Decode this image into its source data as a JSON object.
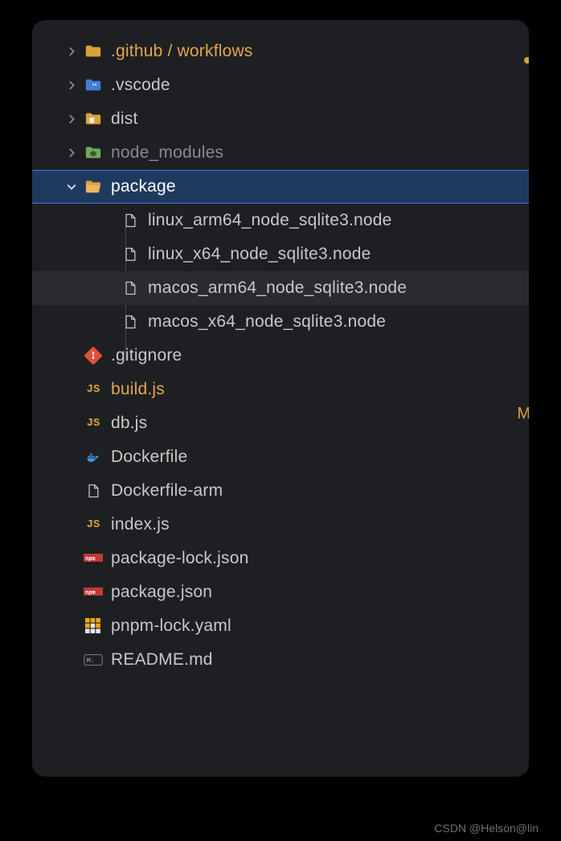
{
  "tree": {
    "items": [
      {
        "type": "folder",
        "label": ".github / workflows",
        "expanded": false,
        "icon": "folder-git",
        "highlighted": true,
        "indent": 0
      },
      {
        "type": "folder",
        "label": ".vscode",
        "expanded": false,
        "icon": "folder-vscode",
        "indent": 0
      },
      {
        "type": "folder",
        "label": "dist",
        "expanded": false,
        "icon": "folder-dist",
        "indent": 0
      },
      {
        "type": "folder",
        "label": "node_modules",
        "expanded": false,
        "icon": "folder-node",
        "muted": true,
        "indent": 0
      },
      {
        "type": "folder",
        "label": "package",
        "expanded": true,
        "icon": "folder-open",
        "selected": true,
        "indent": 0
      },
      {
        "type": "file",
        "label": "linux_arm64_node_sqlite3.node",
        "icon": "file",
        "indent": 1
      },
      {
        "type": "file",
        "label": "linux_x64_node_sqlite3.node",
        "icon": "file",
        "indent": 1
      },
      {
        "type": "file",
        "label": "macos_arm64_node_sqlite3.node",
        "icon": "file",
        "hovered": true,
        "indent": 1
      },
      {
        "type": "file",
        "label": "macos_x64_node_sqlite3.node",
        "icon": "file",
        "indent": 1
      },
      {
        "type": "file",
        "label": ".gitignore",
        "icon": "git",
        "indent": 0
      },
      {
        "type": "file",
        "label": "build.js",
        "icon": "js",
        "highlighted": true,
        "indent": 0
      },
      {
        "type": "file",
        "label": "db.js",
        "icon": "js",
        "indent": 0
      },
      {
        "type": "file",
        "label": "Dockerfile",
        "icon": "docker",
        "indent": 0
      },
      {
        "type": "file",
        "label": "Dockerfile-arm",
        "icon": "file",
        "indent": 0
      },
      {
        "type": "file",
        "label": "index.js",
        "icon": "js",
        "indent": 0
      },
      {
        "type": "file",
        "label": "package-lock.json",
        "icon": "npm",
        "indent": 0
      },
      {
        "type": "file",
        "label": "package.json",
        "icon": "npm",
        "indent": 0
      },
      {
        "type": "file",
        "label": "pnpm-lock.yaml",
        "icon": "pnpm",
        "indent": 0
      },
      {
        "type": "file",
        "label": "README.md",
        "icon": "md",
        "indent": 0
      }
    ]
  },
  "status_letter": "M",
  "watermark": "CSDN @Helson@lin"
}
